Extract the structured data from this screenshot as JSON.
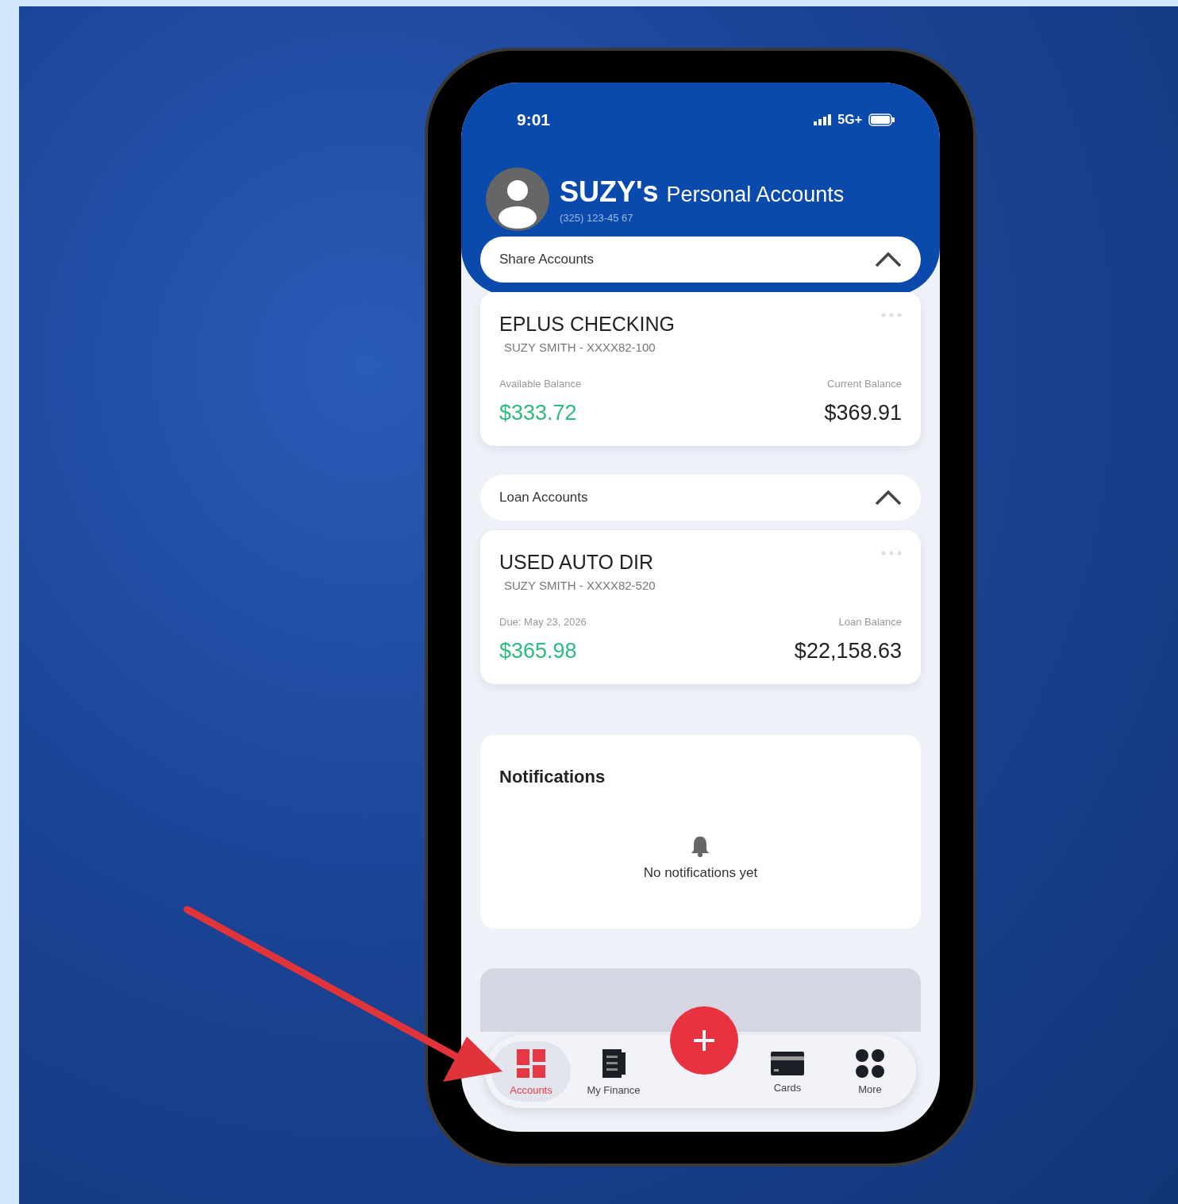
{
  "status_bar": {
    "time": "9:01",
    "network": "5G+"
  },
  "header": {
    "name": "SUZY's",
    "title": "Personal Accounts",
    "phone": "(325) 123-45 67"
  },
  "sections": [
    {
      "title": "Share Accounts",
      "expanded": true,
      "accounts": [
        {
          "name": "EPLUS CHECKING",
          "owner": "SUZY SMITH - XXXX82-100",
          "left_label": "Available Balance",
          "left_value": "$333.72",
          "right_label": "Current Balance",
          "right_value": "$369.91"
        }
      ]
    },
    {
      "title": "Loan Accounts",
      "expanded": true,
      "accounts": [
        {
          "name": "USED AUTO DIR",
          "owner": "SUZY SMITH - XXXX82-520",
          "left_label": "Due: May 23, 2026",
          "left_value": "$365.98",
          "right_label": "Loan Balance",
          "right_value": "$22,158.63"
        }
      ]
    }
  ],
  "notifications": {
    "title": "Notifications",
    "empty_text": "No notifications yet"
  },
  "nav": [
    {
      "label": "Accounts",
      "selected": true,
      "kind": "grid"
    },
    {
      "label": "My Finance",
      "selected": false,
      "kind": "finance"
    },
    {
      "label": "Cards",
      "selected": false,
      "kind": "card"
    },
    {
      "label": "More",
      "selected": false,
      "kind": "dots"
    }
  ]
}
